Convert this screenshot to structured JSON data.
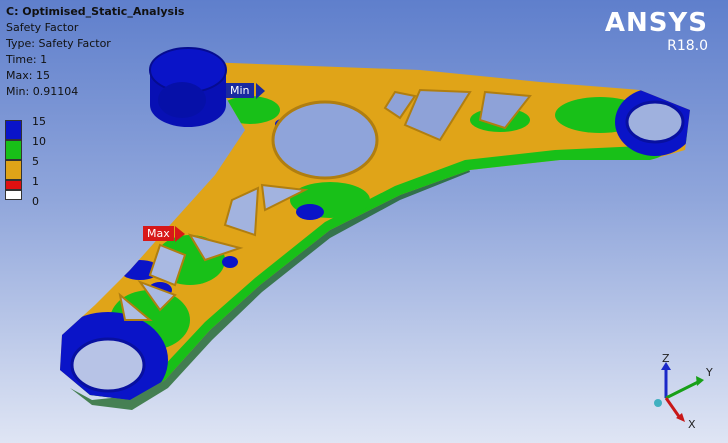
{
  "analysis": {
    "title": "C: Optimised_Static_Analysis",
    "result_name": "Safety Factor",
    "type_line": "Type: Safety Factor",
    "time_line": "Time: 1",
    "max_line": "Max: 15",
    "min_line": "Min: 0.91104"
  },
  "legend": {
    "levels": [
      {
        "label": "15",
        "color": "#0a14c8"
      },
      {
        "label": "10",
        "color": "#18c018"
      },
      {
        "label": "5",
        "color": "#e0a418"
      },
      {
        "label": "1",
        "color": "#e01010"
      },
      {
        "label": "0",
        "color": "#ffffff"
      }
    ]
  },
  "brand": {
    "name": "ANSYS",
    "version": "R18.0"
  },
  "probes": {
    "min_label": "Min",
    "max_label": "Max"
  },
  "triad": {
    "x": "X",
    "y": "Y",
    "z": "Z"
  },
  "colors": {
    "blue": "#0a14c8",
    "green": "#18c018",
    "orange": "#e0a418",
    "red": "#e01010"
  }
}
